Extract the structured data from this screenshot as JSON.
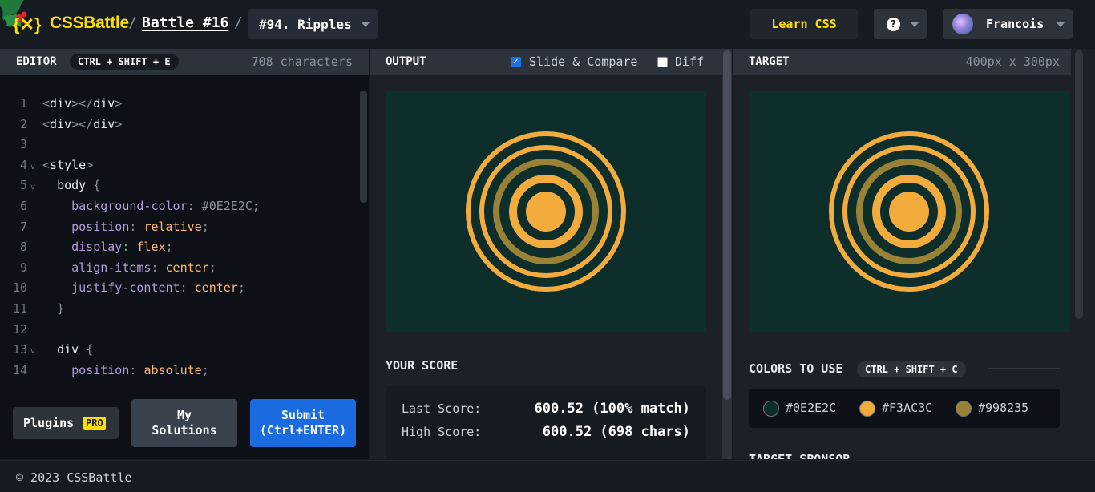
{
  "header": {
    "logo_mark": "{✕}",
    "logo_text": "CSSBattle",
    "sep": "/",
    "battle_label": "Battle #16",
    "target_label": "#94. Ripples",
    "learn_label": "Learn CSS",
    "help_glyph": "?",
    "user_name": "Francois"
  },
  "editor": {
    "title": "EDITOR",
    "shortcut": "CTRL + SHIFT + E",
    "char_count": "708 characters",
    "lines": [
      {
        "n": "1",
        "fold": "",
        "html": "<span class='c-punc'>&lt;</span><span class='c-tag'>div</span><span class='c-punc'>&gt;&lt;/</span><span class='c-tag'>div</span><span class='c-punc'>&gt;</span>"
      },
      {
        "n": "2",
        "fold": "",
        "html": "<span class='c-punc'>&lt;</span><span class='c-tag'>div</span><span class='c-punc'>&gt;&lt;/</span><span class='c-tag'>div</span><span class='c-punc'>&gt;</span>"
      },
      {
        "n": "3",
        "fold": "",
        "html": ""
      },
      {
        "n": "4",
        "fold": "v",
        "html": "<span class='c-punc'>&lt;</span><span class='c-tag'>style</span><span class='c-punc'>&gt;</span>"
      },
      {
        "n": "5",
        "fold": "v",
        "html": "  <span class='c-sel'>body</span> <span class='c-punc'>{</span>"
      },
      {
        "n": "6",
        "fold": "",
        "html": "    <span class='c-prop'>background-color</span><span class='c-punc'>:</span> <span class='c-hex'>#0E2E2C</span><span class='c-punc'>;</span>"
      },
      {
        "n": "7",
        "fold": "",
        "html": "    <span class='c-prop'>position</span><span class='c-punc'>:</span> <span class='c-val'>relative</span><span class='c-punc'>;</span>"
      },
      {
        "n": "8",
        "fold": "",
        "html": "    <span class='c-prop'>display</span><span class='c-punc'>:</span> <span class='c-val'>flex</span><span class='c-punc'>;</span>"
      },
      {
        "n": "9",
        "fold": "",
        "html": "    <span class='c-prop'>align-items</span><span class='c-punc'>:</span> <span class='c-val'>center</span><span class='c-punc'>;</span>"
      },
      {
        "n": "10",
        "fold": "",
        "html": "    <span class='c-prop'>justify-content</span><span class='c-punc'>:</span> <span class='c-val'>center</span><span class='c-punc'>;</span>"
      },
      {
        "n": "11",
        "fold": "",
        "html": "  <span class='c-punc'>}</span>"
      },
      {
        "n": "12",
        "fold": "",
        "html": ""
      },
      {
        "n": "13",
        "fold": "v",
        "html": "  <span class='c-sel'>div</span> <span class='c-punc'>{</span>"
      },
      {
        "n": "14",
        "fold": "",
        "html": "    <span class='c-prop'>position</span><span class='c-punc'>:</span> <span class='c-val'>absolute</span><span class='c-punc'>;</span>"
      }
    ],
    "plugins_label": "Plugins",
    "pro_badge": "PRO",
    "solutions_label_1": "My",
    "solutions_label_2": "Solutions",
    "submit_label_1": "Submit",
    "submit_label_2": "(Ctrl+ENTER)"
  },
  "output": {
    "title": "OUTPUT",
    "slide_label": "Slide & Compare",
    "slide_checked": true,
    "diff_label": "Diff",
    "diff_checked": false,
    "score_title": "YOUR SCORE",
    "last_score_label": "Last Score:",
    "last_score_value": "600.52 (100% match)",
    "high_score_label": "High Score:",
    "high_score_value": "600.52 (698 chars)"
  },
  "target": {
    "title": "TARGET",
    "size": "400px x 300px",
    "colors_title": "COLORS TO USE",
    "colors_shortcut": "CTRL + SHIFT + C",
    "colors": [
      {
        "hex": "#0E2E2C",
        "swatch": "#0e2e2c"
      },
      {
        "hex": "#F3AC3C",
        "swatch": "#f3ac3c"
      },
      {
        "hex": "#998235",
        "swatch": "#998235"
      }
    ],
    "sponsor_title": "TARGET SPONSOR"
  },
  "footer": {
    "copyright": "© 2023 CSSBattle"
  }
}
